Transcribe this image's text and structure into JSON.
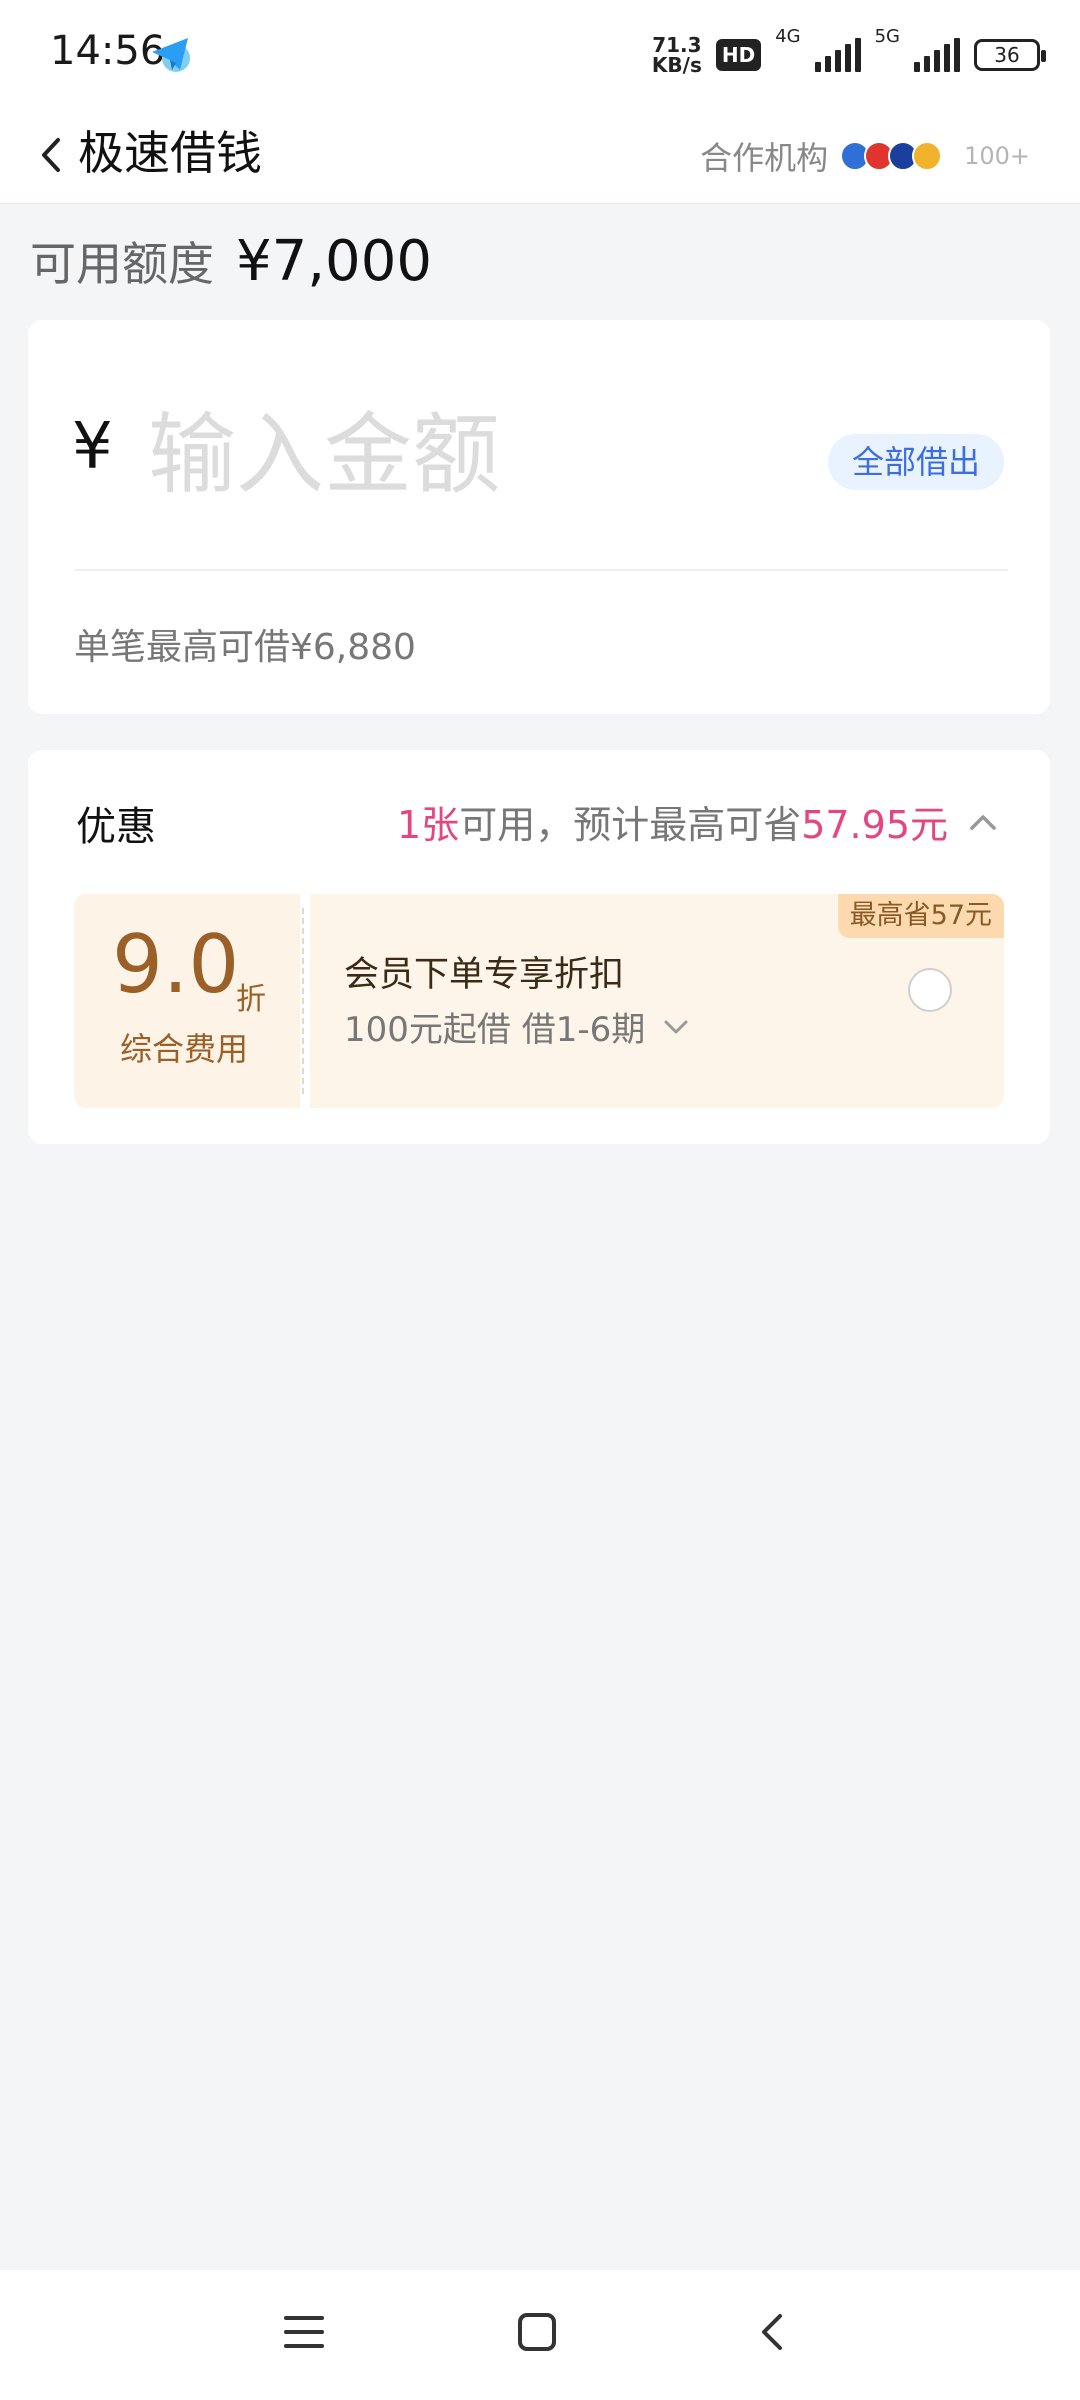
{
  "status_bar": {
    "time": "14:56",
    "app_icon": "telegram-paper-plane-icon",
    "speed_value": "71.3",
    "speed_unit": "KB/s",
    "hd_label": "HD",
    "network_1": "4G",
    "network_2": "5G",
    "battery": "36"
  },
  "nav": {
    "title": "极速借钱",
    "partner_label": "合作机构",
    "partner_count": "100+"
  },
  "credit": {
    "label": "可用额度",
    "amount": "¥7,000"
  },
  "amount_card": {
    "currency": "¥",
    "placeholder": "输入金额",
    "borrow_all_label": "全部借出",
    "max_single": "单笔最高可借¥6,880"
  },
  "discount": {
    "label": "优惠",
    "count": "1张",
    "available_text": "可用，预计最高可省",
    "save_amount": "57.95元",
    "coupon": {
      "rate": "9.0",
      "rate_unit": "折",
      "rate_label": "综合费用",
      "title": "会员下单专享折扣",
      "subtitle": "100元起借 借1-6期",
      "badge": "最高省57元",
      "selected": false
    }
  },
  "colors": {
    "accent_pink": "#e44682",
    "accent_blue": "#3b6fe0",
    "coupon_brown": "#9a6028",
    "coupon_bg": "#fdf3e6"
  }
}
